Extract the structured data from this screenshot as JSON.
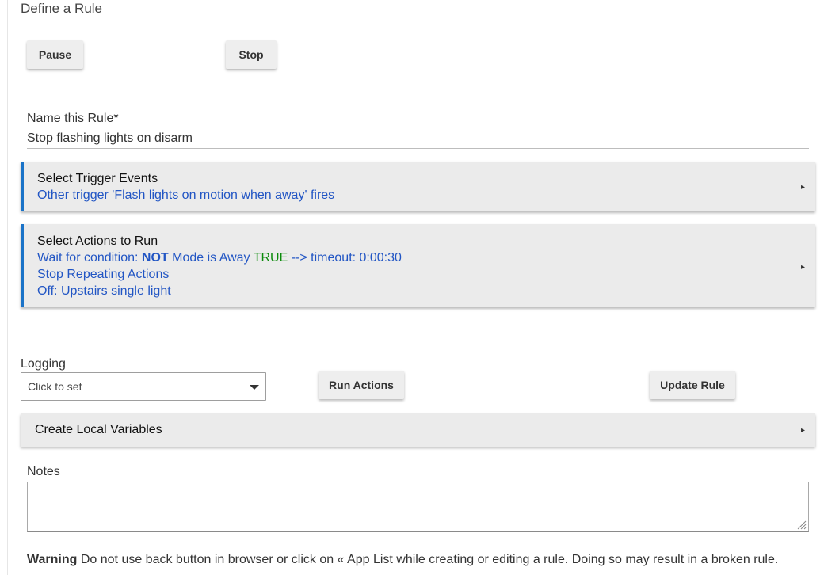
{
  "page": {
    "title": "Define a Rule"
  },
  "controls": {
    "pause_label": "Pause",
    "stop_label": "Stop"
  },
  "rule_name": {
    "label": "Name this Rule*",
    "value": "Stop flashing lights on disarm"
  },
  "triggers": {
    "title": "Select Trigger Events",
    "summary": "Other trigger 'Flash lights on motion when away' fires"
  },
  "actions": {
    "title": "Select Actions to Run",
    "line1_prefix": "Wait for condition: ",
    "line1_not": "NOT",
    "line1_middle": " Mode is Away ",
    "line1_true": "TRUE",
    "line1_suffix": " --> timeout: 0:00:30",
    "line2": "Stop Repeating Actions",
    "line3": "Off: Upstairs single light"
  },
  "logging": {
    "label": "Logging",
    "selected": "Click to set"
  },
  "buttons": {
    "run_actions": "Run Actions",
    "update_rule": "Update Rule"
  },
  "local_variables": {
    "title": "Create Local Variables"
  },
  "notes": {
    "label": "Notes",
    "value": ""
  },
  "warning": {
    "bold": "Warning",
    "text": " Do not use back button in browser or click on « App List while creating or editing a rule. Doing so may result in a broken rule."
  },
  "icons": {
    "expand_arrow": "▸"
  },
  "colors": {
    "accent_blue": "#1a73c8",
    "link_blue": "#2155c4",
    "true_green": "#0a8a0a",
    "panel_bg": "#ebebeb"
  }
}
